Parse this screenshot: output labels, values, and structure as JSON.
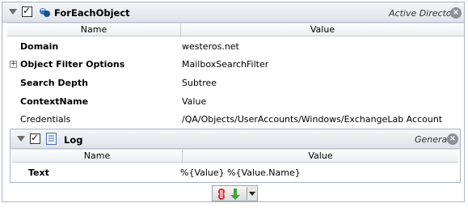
{
  "activity": {
    "title": "ForEachObject",
    "category": "Active Directory",
    "checked": true,
    "columns": {
      "name": "Name",
      "value": "Value"
    },
    "properties": [
      {
        "name": "Domain",
        "value": "westeros.net",
        "bold": true
      },
      {
        "name": "Object Filter Options",
        "value": "MailboxSearchFilter",
        "bold": true,
        "expandable": true
      },
      {
        "name": "Search Depth",
        "value": "Subtree",
        "bold": true
      },
      {
        "name": "ContextName",
        "value": "Value",
        "bold": true
      },
      {
        "name": "Credentials",
        "value": "/QA/Objects/UserAccounts/Windows/ExchangeLab Account",
        "bold": false
      }
    ]
  },
  "child": {
    "title": "Log",
    "category": "General",
    "checked": true,
    "columns": {
      "name": "Name",
      "value": "Value"
    },
    "properties": [
      {
        "name": "Text",
        "value": "%{Value}   %{Value.Name}",
        "bold": true
      }
    ]
  },
  "toolbar": {
    "icons": [
      "stop-icon",
      "download-icon",
      "dropdown-arrow-icon"
    ]
  },
  "colors": {
    "header_top": "#f4f6f8",
    "header_bottom": "#dfe3e8",
    "border": "#a9b5c3",
    "close_button": "#8c9097"
  }
}
